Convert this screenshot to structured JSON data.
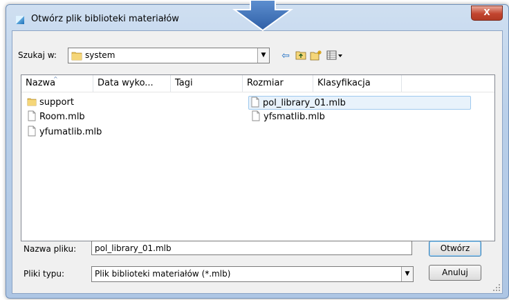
{
  "window": {
    "title": "Otwórz plik biblioteki materiałów",
    "close_label": "X"
  },
  "lookin": {
    "label": "Szukaj w:",
    "value": "system"
  },
  "toolbar": {
    "back_icon": "back-arrow-icon",
    "up_icon": "up-folder-icon",
    "new_folder_icon": "new-folder-icon",
    "views_icon": "views-menu-icon"
  },
  "columns": [
    "Nazwa",
    "Data wyko...",
    "Tagi",
    "Rozmiar",
    "Klasyfikacja"
  ],
  "files": [
    {
      "name": "support",
      "type": "folder"
    },
    {
      "name": "Room.mlb",
      "type": "file"
    },
    {
      "name": "yfumatlib.mlb",
      "type": "file"
    },
    {
      "name": "pol_library_01.mlb",
      "type": "file",
      "selected": true
    },
    {
      "name": "yfsmatlib.mlb",
      "type": "file"
    }
  ],
  "filename": {
    "label": "Nazwa pliku:",
    "value": "pol_library_01.mlb"
  },
  "filetype": {
    "label": "Pliki typu:",
    "value": "Plik biblioteki materiałów (*.mlb)"
  },
  "buttons": {
    "open": "Otwórz",
    "cancel": "Anuluj"
  },
  "colors": {
    "title_gradient": "#b9cfe9",
    "close": "#c2452f",
    "selection": "#e8f2fb",
    "arrow": "#4a78b8"
  }
}
